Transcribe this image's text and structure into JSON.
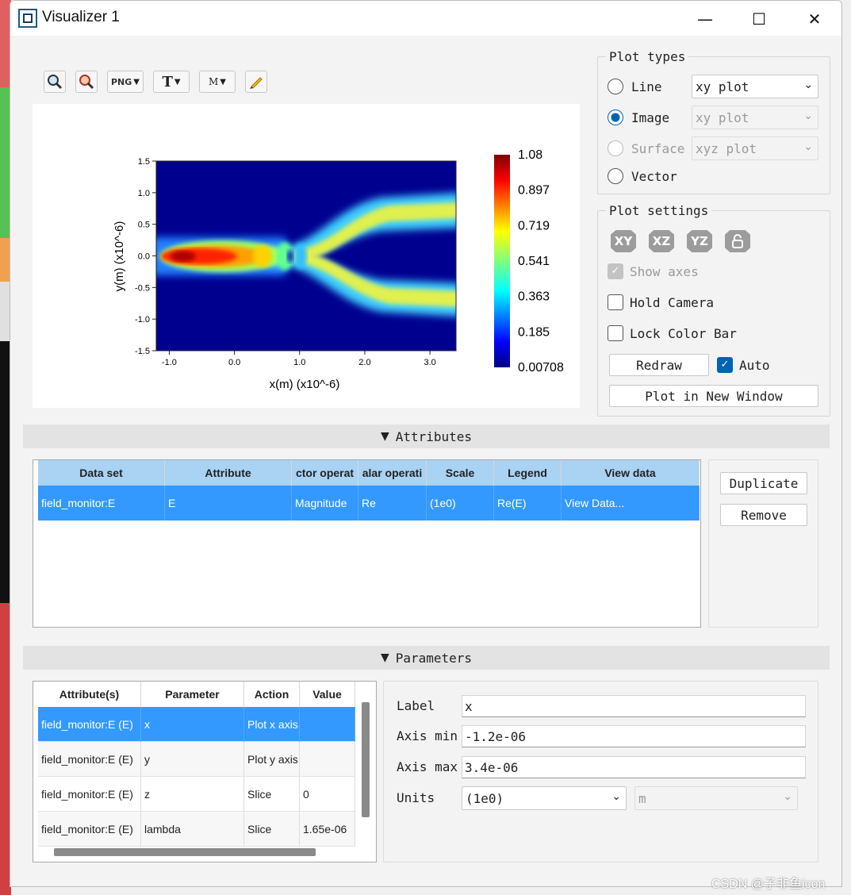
{
  "window": {
    "title": "Visualizer 1",
    "controls": {
      "minimize": "—",
      "maximize": "☐",
      "close": "✕"
    }
  },
  "toolbar": {
    "png_label": "PNG",
    "text_label": "T",
    "movie_label": "M"
  },
  "chart_data": {
    "type": "heatmap",
    "xlabel": "x(m) (x10^-6)",
    "ylabel": "y(m) (x10^-6)",
    "x_ticks": [
      "-1.0",
      "0.0",
      "1.0",
      "2.0",
      "3.0"
    ],
    "y_ticks": [
      "1.5",
      "1.0",
      "0.5",
      "0.0",
      "-0.5",
      "-1.0",
      "-1.5"
    ],
    "xlim": [
      -1.2,
      3.4
    ],
    "ylim": [
      -1.5,
      1.5
    ],
    "colorbar_ticks": [
      "1.08",
      "0.897",
      "0.719",
      "0.541",
      "0.363",
      "0.185",
      "0.00708"
    ],
    "colorbar_range": [
      0.00708,
      1.08
    ],
    "colormap": "jet",
    "description_values": {
      "input_waveguide_y": 0.0,
      "output_branch_y": [
        0.7,
        -0.7
      ],
      "split_start_x": 1.0
    }
  },
  "plot_types": {
    "title": "Plot types",
    "options": [
      {
        "label": "Line",
        "selected": false,
        "enabled": true,
        "combo": "xy plot"
      },
      {
        "label": "Image",
        "selected": true,
        "enabled": true,
        "combo": "xy plot"
      },
      {
        "label": "Surface",
        "selected": false,
        "enabled": false,
        "combo": "xyz plot"
      },
      {
        "label": "Vector",
        "selected": false,
        "enabled": true,
        "combo": ""
      }
    ]
  },
  "plot_settings": {
    "title": "Plot settings",
    "view_buttons": [
      "XY",
      "XZ",
      "YZ"
    ],
    "show_axes": "Show axes",
    "hold_camera": "Hold Camera",
    "lock_color_bar": "Lock Color Bar",
    "redraw": "Redraw",
    "auto": "Auto",
    "plot_new_window": "Plot in New Window"
  },
  "attributes": {
    "header": "Attributes",
    "columns": [
      "Data set",
      "Attribute",
      "ctor operat",
      "alar operati",
      "Scale",
      "Legend",
      "View data"
    ],
    "rows": [
      [
        "field_monitor:E",
        "E",
        "Magnitude",
        "Re",
        "(1e0)",
        "Re(E)",
        "View Data..."
      ]
    ],
    "duplicate": "Duplicate",
    "remove": "Remove"
  },
  "parameters": {
    "header": "Parameters",
    "columns": [
      "Attribute(s)",
      "Parameter",
      "Action",
      "Value"
    ],
    "rows": [
      [
        "field_monitor:E (E)",
        "x",
        "Plot x axis",
        ""
      ],
      [
        "field_monitor:E (E)",
        "y",
        "Plot y axis",
        ""
      ],
      [
        "field_monitor:E (E)",
        "z",
        "Slice",
        "0"
      ],
      [
        "field_monitor:E (E)",
        "lambda",
        "Slice",
        "1.65e-06"
      ]
    ],
    "label_label": "Label",
    "label_value": "x",
    "axis_min_label": "Axis min",
    "axis_min_value": "-1.2e-06",
    "axis_max_label": "Axis max",
    "axis_max_value": "3.4e-06",
    "units_label": "Units",
    "units_value": "(1e0)",
    "units_unit": "m"
  },
  "watermark": "CSDN @子非鱼icon",
  "colors": {
    "accent": "#0063b1",
    "selected_row": "#3399ff",
    "header_row": "#a9d2f3"
  }
}
